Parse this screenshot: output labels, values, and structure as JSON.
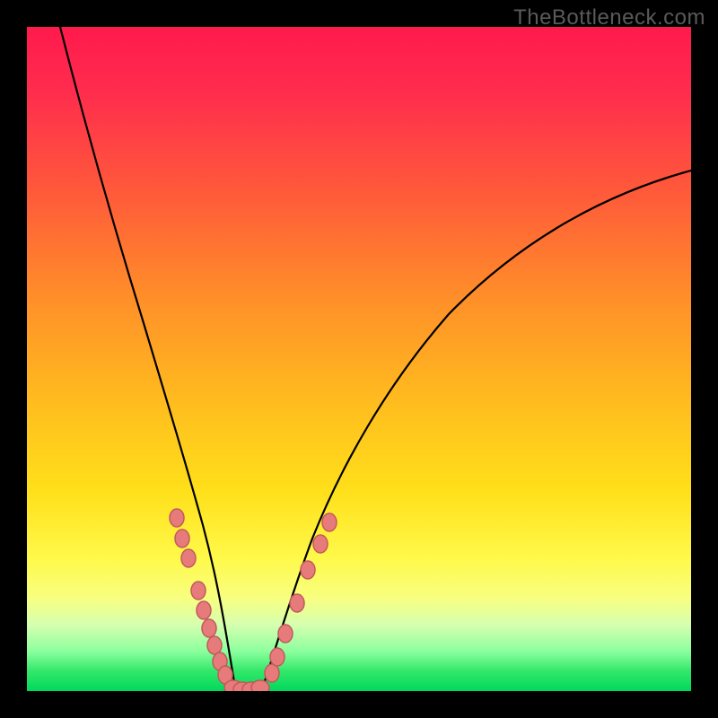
{
  "watermark": "TheBottleneck.com",
  "chart_data": {
    "type": "line",
    "title": "",
    "xlabel": "",
    "ylabel": "",
    "xlim": [
      0,
      100
    ],
    "ylim": [
      0,
      100
    ],
    "series": [
      {
        "name": "left-curve",
        "x": [
          5,
          7,
          9,
          11,
          13,
          15,
          17,
          19,
          21,
          23,
          24.5,
          26,
          27.5,
          29,
          30.5
        ],
        "y": [
          100,
          88,
          77,
          67,
          58,
          50,
          43,
          36,
          30,
          24,
          19,
          14,
          9,
          4,
          0
        ]
      },
      {
        "name": "valley-flat",
        "x": [
          30.5,
          31.5,
          33,
          34.5,
          36
        ],
        "y": [
          0,
          0,
          0,
          0,
          0
        ]
      },
      {
        "name": "right-curve",
        "x": [
          36,
          38,
          40.5,
          44,
          48,
          53,
          59,
          66,
          74,
          83,
          92,
          100
        ],
        "y": [
          0,
          6,
          13,
          22,
          31,
          40,
          48,
          56,
          63,
          69,
          74,
          78
        ]
      }
    ],
    "markers": {
      "name": "beads",
      "points": [
        {
          "x": 22.5,
          "y": 26
        },
        {
          "x": 23.4,
          "y": 23
        },
        {
          "x": 24.3,
          "y": 20
        },
        {
          "x": 25.8,
          "y": 15
        },
        {
          "x": 26.6,
          "y": 12
        },
        {
          "x": 27.4,
          "y": 9.5
        },
        {
          "x": 28.2,
          "y": 7
        },
        {
          "x": 29.0,
          "y": 4.5
        },
        {
          "x": 29.7,
          "y": 2.3
        },
        {
          "x": 31.0,
          "y": 0.3
        },
        {
          "x": 32.3,
          "y": 0.2
        },
        {
          "x": 33.6,
          "y": 0.2
        },
        {
          "x": 34.9,
          "y": 0.3
        },
        {
          "x": 36.8,
          "y": 2.5
        },
        {
          "x": 37.5,
          "y": 5
        },
        {
          "x": 38.7,
          "y": 8.5
        },
        {
          "x": 40.5,
          "y": 13
        },
        {
          "x": 42.2,
          "y": 18
        },
        {
          "x": 44.0,
          "y": 22
        },
        {
          "x": 45.3,
          "y": 25
        }
      ]
    },
    "background_gradient": {
      "top": "#ff1a4d",
      "bottom": "#00d85c"
    }
  }
}
